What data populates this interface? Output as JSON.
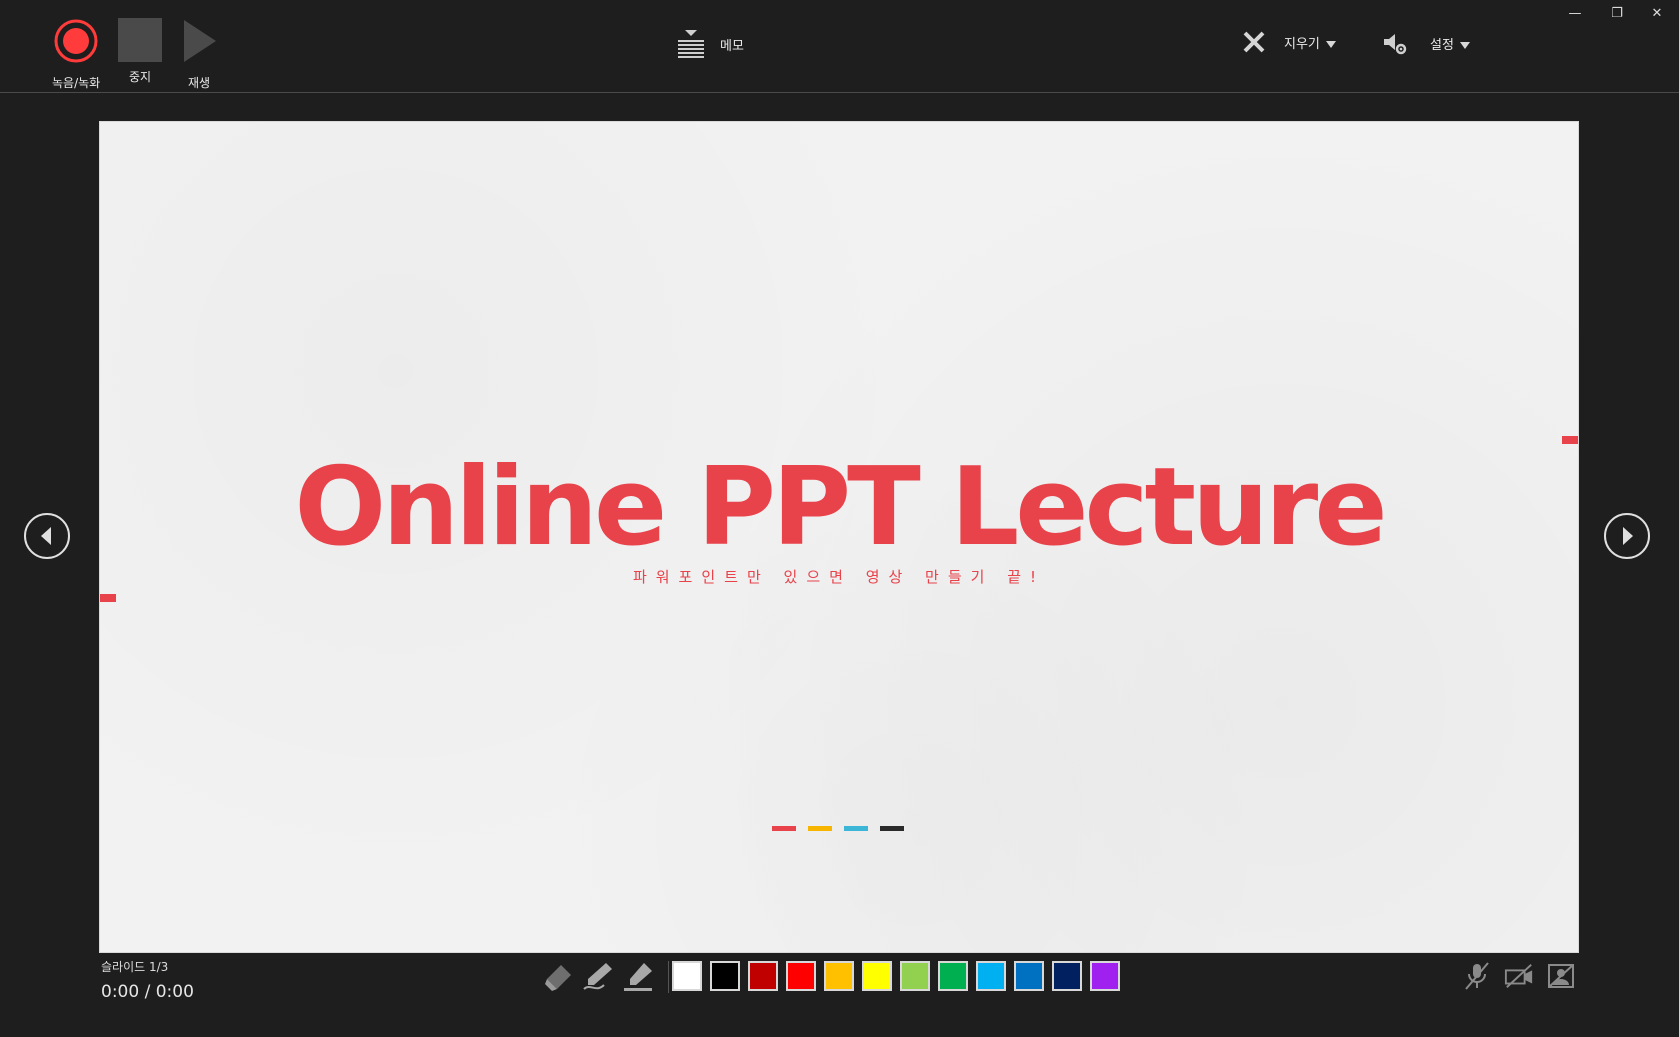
{
  "toolbar": {
    "record_label": "녹음/녹화",
    "stop_label": "중지",
    "play_label": "재생",
    "memo_label": "메모",
    "erase_label": "지우기",
    "settings_label": "설정"
  },
  "window_controls": {
    "minimize": "—",
    "restore": "❐",
    "close": "✕"
  },
  "slide": {
    "title": "Online PPT Lecture",
    "subtitle": "파워포인트만 있으면 영상 만들기 끝!",
    "dot_colors": [
      "#e8424a",
      "#f7b500",
      "#3bb6d6",
      "#2a2a2a"
    ]
  },
  "status": {
    "slide_counter": "슬라이드 1/3",
    "time": "0:00  /  0:00"
  },
  "pen_tools": [
    "eraser-icon",
    "pen-icon",
    "highlighter-icon"
  ],
  "ink_colors": [
    "#ffffff",
    "#000000",
    "#c00000",
    "#ff0000",
    "#ffc000",
    "#ffff00",
    "#92d050",
    "#00b050",
    "#00b0f0",
    "#0070c0",
    "#002060",
    "#a020f0"
  ],
  "media": [
    "microphone-off-icon",
    "camera-off-icon",
    "camera-preview-off-icon"
  ],
  "colors": {
    "background": "#1e1e1e",
    "accent_red": "#e8424a",
    "record_red": "#ff3b3b"
  }
}
